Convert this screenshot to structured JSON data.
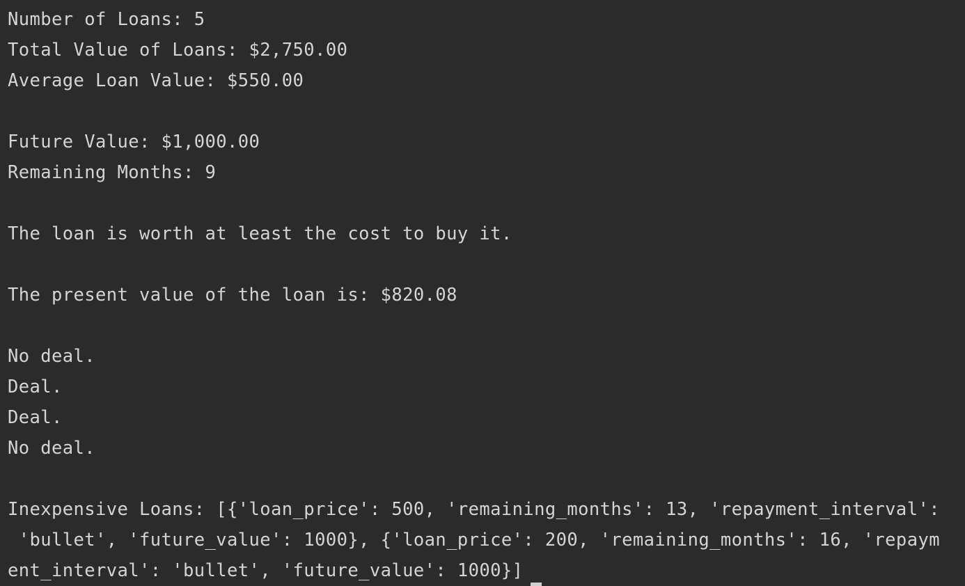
{
  "console": {
    "lines": [
      "Number of Loans: 5",
      "Total Value of Loans: $2,750.00",
      "Average Loan Value: $550.00",
      "",
      "Future Value: $1,000.00",
      "Remaining Months: 9",
      "",
      "The loan is worth at least the cost to buy it.",
      "",
      "The present value of the loan is: $820.08",
      "",
      "No deal.",
      "Deal.",
      "Deal.",
      "No deal.",
      "",
      "Inexpensive Loans: [{'loan_price': 500, 'remaining_months': 13, 'repayment_interval':",
      " 'bullet', 'future_value': 1000}, {'loan_price': 200, 'remaining_months': 16, 'repaym",
      "ent_interval': 'bullet', 'future_value': 1000}]"
    ]
  }
}
